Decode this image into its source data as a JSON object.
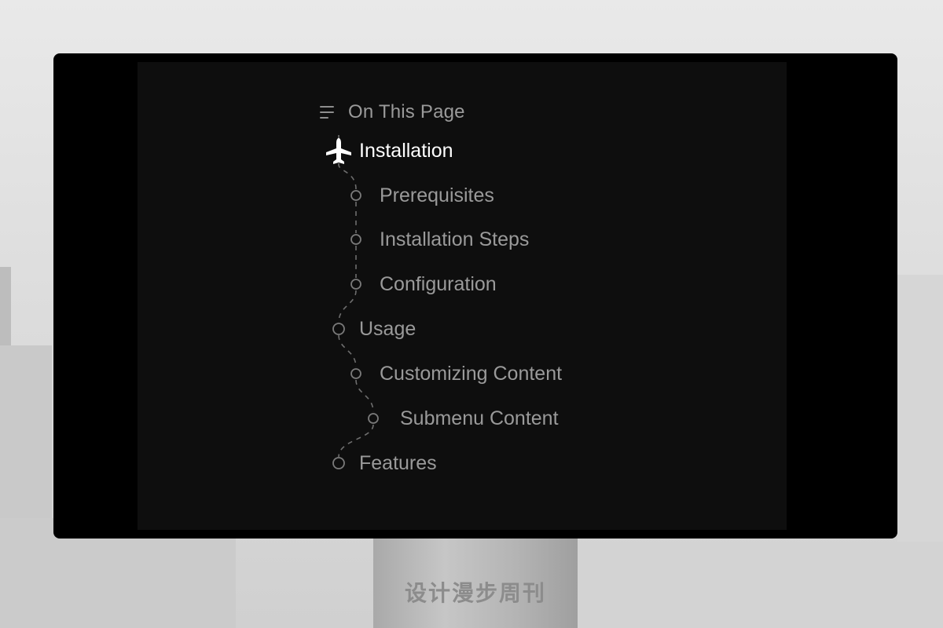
{
  "toc": {
    "header": {
      "icon": "list-lines-icon",
      "title": "On This Page"
    },
    "items": [
      {
        "label": "Installation",
        "level": 1,
        "active": true,
        "marker": "airplane-icon"
      },
      {
        "label": "Prerequisites",
        "level": 2,
        "active": false,
        "marker": "circle-dot-icon"
      },
      {
        "label": "Installation Steps",
        "level": 2,
        "active": false,
        "marker": "circle-dot-icon"
      },
      {
        "label": "Configuration",
        "level": 2,
        "active": false,
        "marker": "circle-dot-icon"
      },
      {
        "label": "Usage",
        "level": 1,
        "active": false,
        "marker": "circle-dot-icon"
      },
      {
        "label": "Customizing Content",
        "level": 2,
        "active": false,
        "marker": "circle-dot-icon"
      },
      {
        "label": "Submenu Content",
        "level": 3,
        "active": false,
        "marker": "circle-dot-icon"
      },
      {
        "label": "Features",
        "level": 1,
        "active": false,
        "marker": "circle-dot-icon"
      }
    ]
  },
  "stand": {
    "caption": "设计漫步周刊"
  },
  "colors": {
    "screen_bg": "#0e0e0e",
    "active_text": "#ffffff",
    "inactive_text": "#9a9a9a",
    "track_line": "#6e6e6e"
  }
}
